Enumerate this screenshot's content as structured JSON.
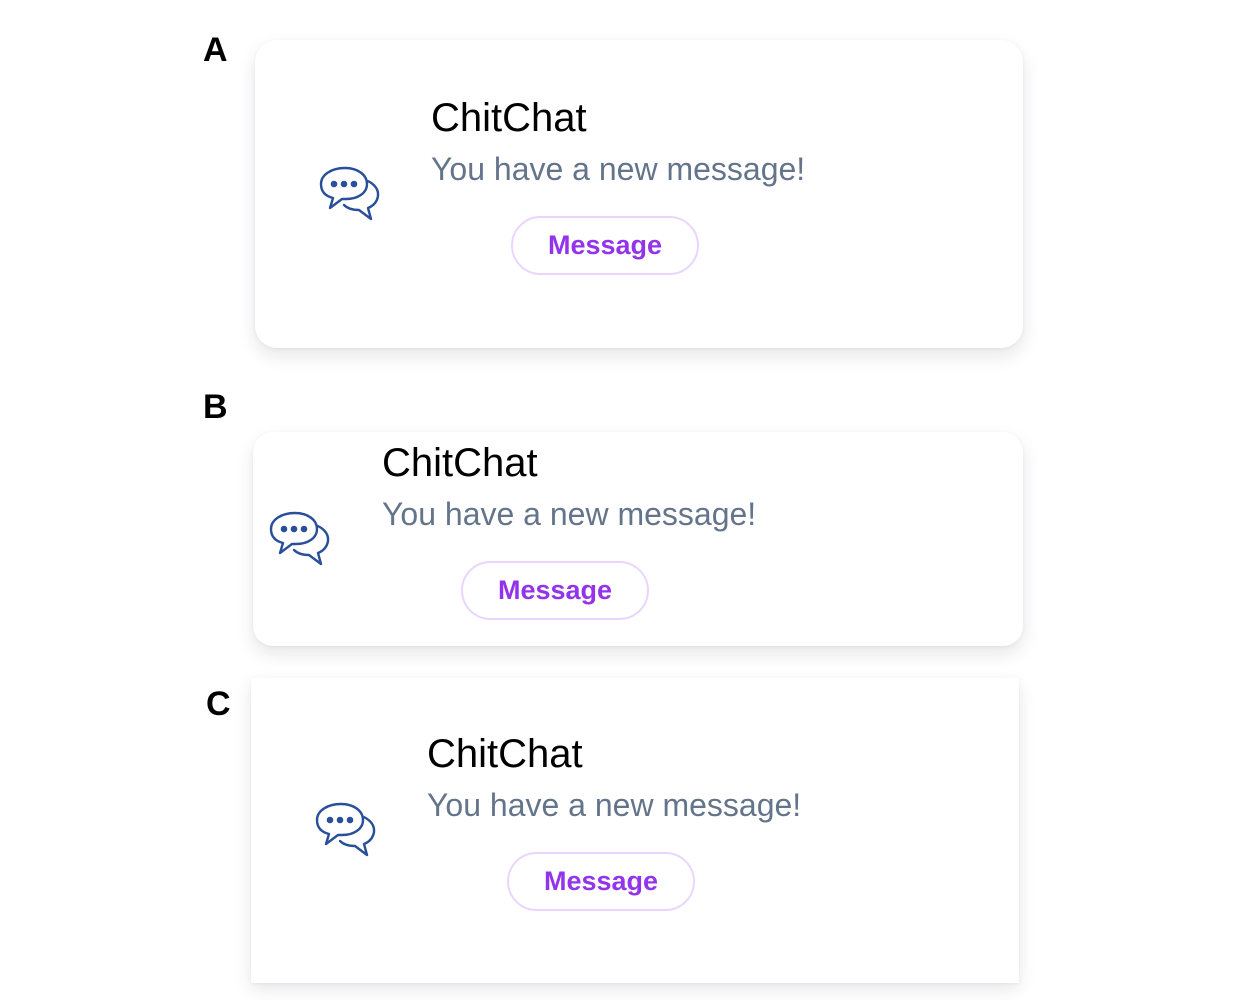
{
  "panels": [
    {
      "letter": "A",
      "title": "ChitChat",
      "text": "You have a new message!",
      "button_label": "Message"
    },
    {
      "letter": "B",
      "title": "ChitChat",
      "text": "You have a new message!",
      "button_label": "Message"
    },
    {
      "letter": "C",
      "title": "ChitChat",
      "text": "You have a new message!",
      "button_label": "Message"
    }
  ],
  "icon": "chat-bubbles-icon",
  "colors": {
    "icon": "#2a4f9a",
    "title": "#000000",
    "text": "#64748b",
    "button_text": "#9333ea",
    "button_border": "#e9d5ff"
  }
}
